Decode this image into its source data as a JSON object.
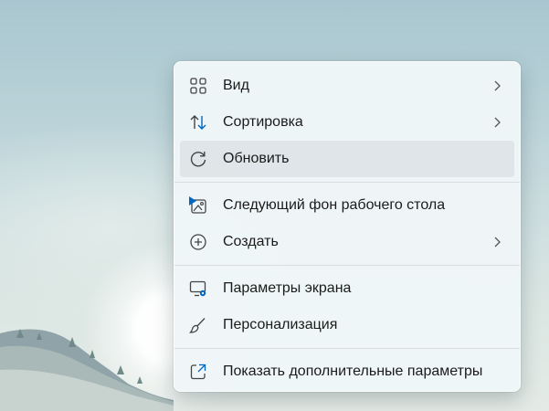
{
  "menu": {
    "items": [
      {
        "label": "Вид",
        "icon": "view-grid-icon",
        "submenu": true
      },
      {
        "label": "Сортировка",
        "icon": "sort-arrows-icon",
        "submenu": true
      },
      {
        "label": "Обновить",
        "icon": "refresh-icon",
        "submenu": false,
        "highlighted": true
      },
      {
        "label": "Следующий фон рабочего стола",
        "icon": "next-wallpaper-icon",
        "submenu": false
      },
      {
        "label": "Создать",
        "icon": "new-plus-icon",
        "submenu": true
      },
      {
        "label": "Параметры экрана",
        "icon": "display-settings-icon",
        "submenu": false
      },
      {
        "label": "Персонализация",
        "icon": "personalize-brush-icon",
        "submenu": false
      },
      {
        "label": "Показать дополнительные параметры",
        "icon": "more-options-icon",
        "submenu": false
      }
    ]
  },
  "colors": {
    "accent": "#0067c0",
    "text": "#1b1b1b",
    "menu_bg": "#f0f6f8"
  }
}
